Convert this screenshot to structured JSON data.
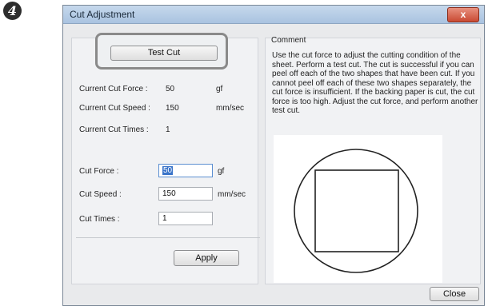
{
  "step_number": "4",
  "window": {
    "title": "Cut Adjustment",
    "close_glyph": "x"
  },
  "test_cut": {
    "label": "Test Cut"
  },
  "current": {
    "force": {
      "label": "Current Cut Force :",
      "value": "50",
      "unit": "gf"
    },
    "speed": {
      "label": "Current Cut Speed :",
      "value": "150",
      "unit": "mm/sec"
    },
    "times": {
      "label": "Current Cut Times :",
      "value": "1"
    }
  },
  "settings": {
    "force": {
      "label": "Cut Force :",
      "value": "50",
      "unit": "gf"
    },
    "speed": {
      "label": "Cut Speed :",
      "value": "150",
      "unit": "mm/sec"
    },
    "times": {
      "label": "Cut Times :",
      "value": "1"
    }
  },
  "apply_label": "Apply",
  "comment": {
    "heading": "Comment",
    "text": "Use the cut force to adjust the cutting condition of the sheet. Perform a test cut. The cut is successful if you can peel off each of the two shapes that have been cut. If you cannot peel off each of these two shapes separately, the cut force is insufficient. If the backing paper is cut, the cut force is too high. Adjust the cut force, and perform another test cut."
  },
  "close_label": "Close",
  "colors": {
    "titlebar": "#a9c3e0",
    "close_red": "#c94a33",
    "selection": "#3a74c9"
  }
}
